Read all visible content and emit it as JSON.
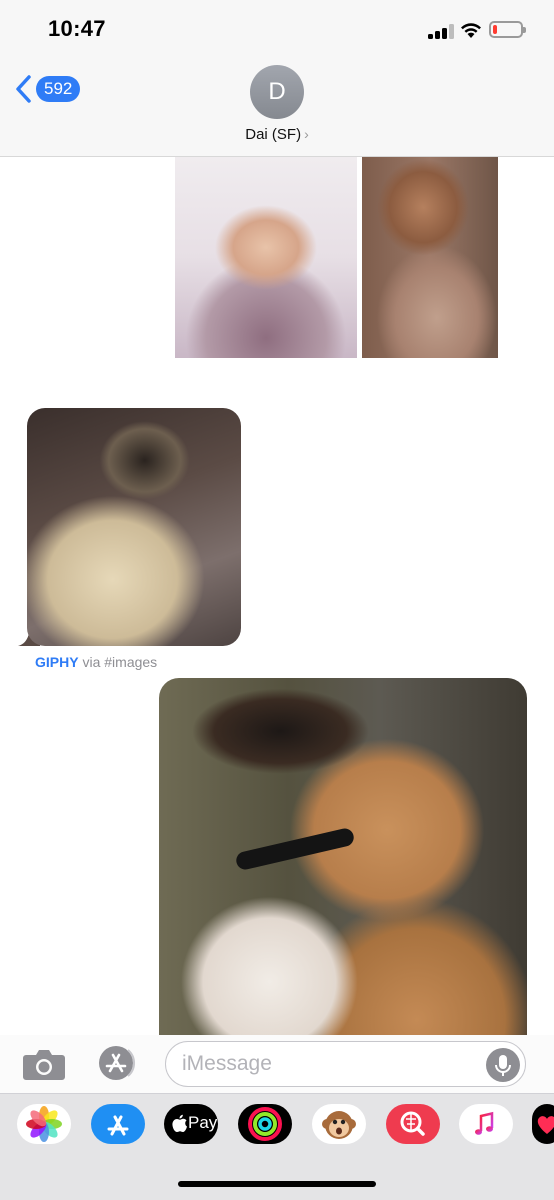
{
  "status_bar": {
    "time": "10:47",
    "battery_level": 0.12
  },
  "nav": {
    "back_count": "592",
    "avatar_initial": "D",
    "contact_name": "Dai (SF)",
    "contact_chevron": "›"
  },
  "thread": {
    "images": [
      {
        "name": "chihuahua-photo-left",
        "description": "photo"
      },
      {
        "name": "chihuahua-photo-right",
        "description": "photo"
      },
      {
        "name": "pug-gif",
        "description": "gif"
      },
      {
        "name": "boxer-puppy-photo",
        "description": "photo"
      }
    ],
    "giphy_caption": {
      "brand": "GIPHY",
      "rest": " via #images"
    }
  },
  "input": {
    "placeholder": "iMessage"
  },
  "app_drawer": {
    "apps": [
      "photos-icon",
      "app-store-icon",
      "apple-pay-icon",
      "activity-icon",
      "animoji-icon",
      "images-search-icon",
      "music-icon",
      "heart-sticker-icon"
    ],
    "apple_pay_label": "Pay"
  },
  "colors": {
    "accent": "#2f7cf6",
    "battery_low": "#ff3b30"
  }
}
